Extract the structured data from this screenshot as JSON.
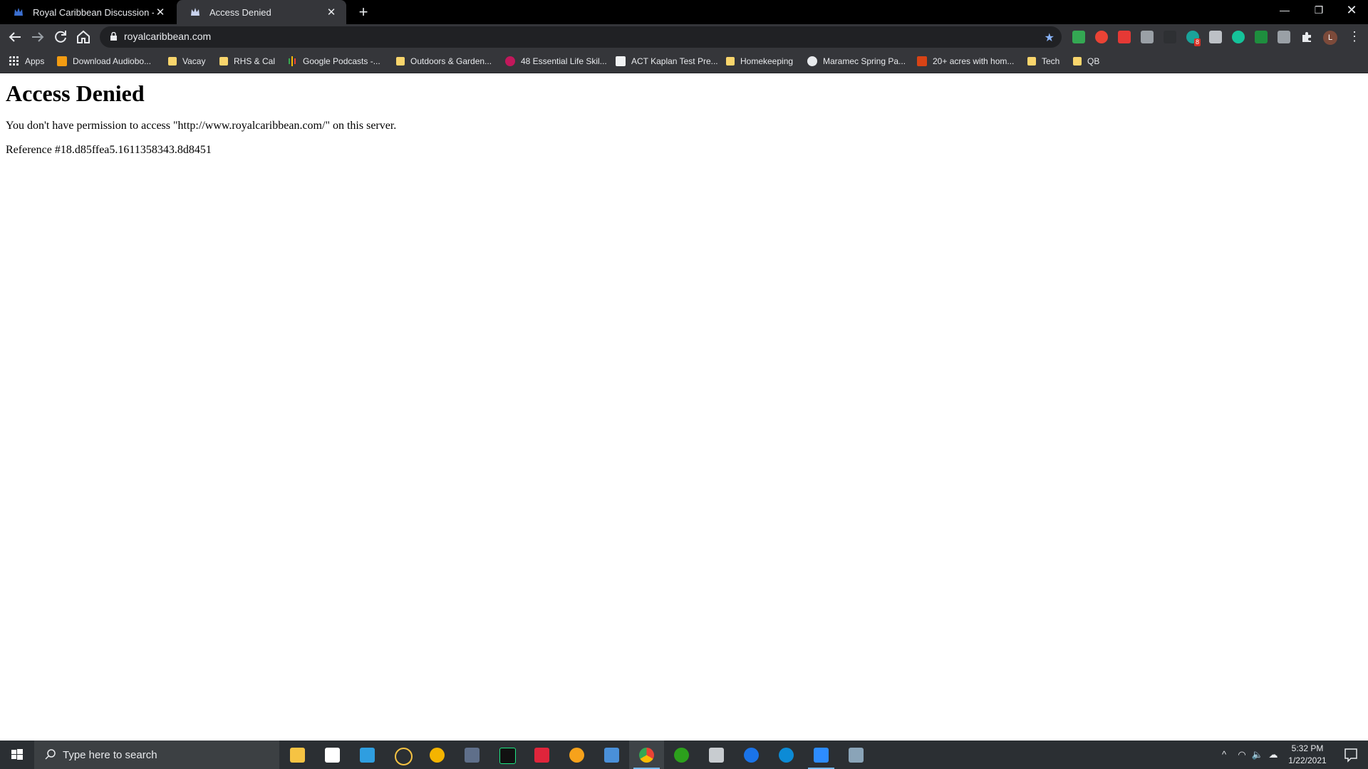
{
  "browser": {
    "tabs": [
      {
        "title": "Royal Caribbean Discussion - Roy",
        "active": false
      },
      {
        "title": "Access Denied",
        "active": true
      }
    ],
    "address": "royalcaribbean.com",
    "avatar_letter": "L",
    "extension_badge": "8",
    "bookmarks": [
      {
        "label": "Apps",
        "icon": "apps-grid-icon"
      },
      {
        "label": "Download Audiobo...",
        "icon": "audiobooks-icon"
      },
      {
        "label": "Vacay",
        "icon": "folder-icon"
      },
      {
        "label": "RHS & Cal",
        "icon": "folder-icon"
      },
      {
        "label": "Google Podcasts -...",
        "icon": "google-podcasts-icon"
      },
      {
        "label": "Outdoors & Garden...",
        "icon": "folder-icon"
      },
      {
        "label": "48 Essential Life Skil...",
        "icon": "flower-icon"
      },
      {
        "label": "ACT Kaplan Test Pre...",
        "icon": "act-icon"
      },
      {
        "label": "Homekeeping",
        "icon": "folder-icon"
      },
      {
        "label": "Maramec Spring Pa...",
        "icon": "wordpress-icon"
      },
      {
        "label": "20+ acres with hom...",
        "icon": "realty-icon"
      },
      {
        "label": "Tech",
        "icon": "folder-icon"
      },
      {
        "label": "QB",
        "icon": "folder-icon"
      }
    ]
  },
  "page": {
    "heading": "Access Denied",
    "message": "You don't have permission to access \"http://www.royalcaribbean.com/\" on this server.",
    "reference": "Reference #18.d85ffea5.1611358343.8d8451"
  },
  "taskbar": {
    "search_placeholder": "Type here to search",
    "time": "5:32 PM",
    "date": "1/22/2021"
  },
  "colors": {
    "tab_strip": "#000000",
    "toolbar": "#35363a",
    "omnibox": "#202124",
    "taskbar": "#2b2f33",
    "accent": "#8ab4f8"
  }
}
